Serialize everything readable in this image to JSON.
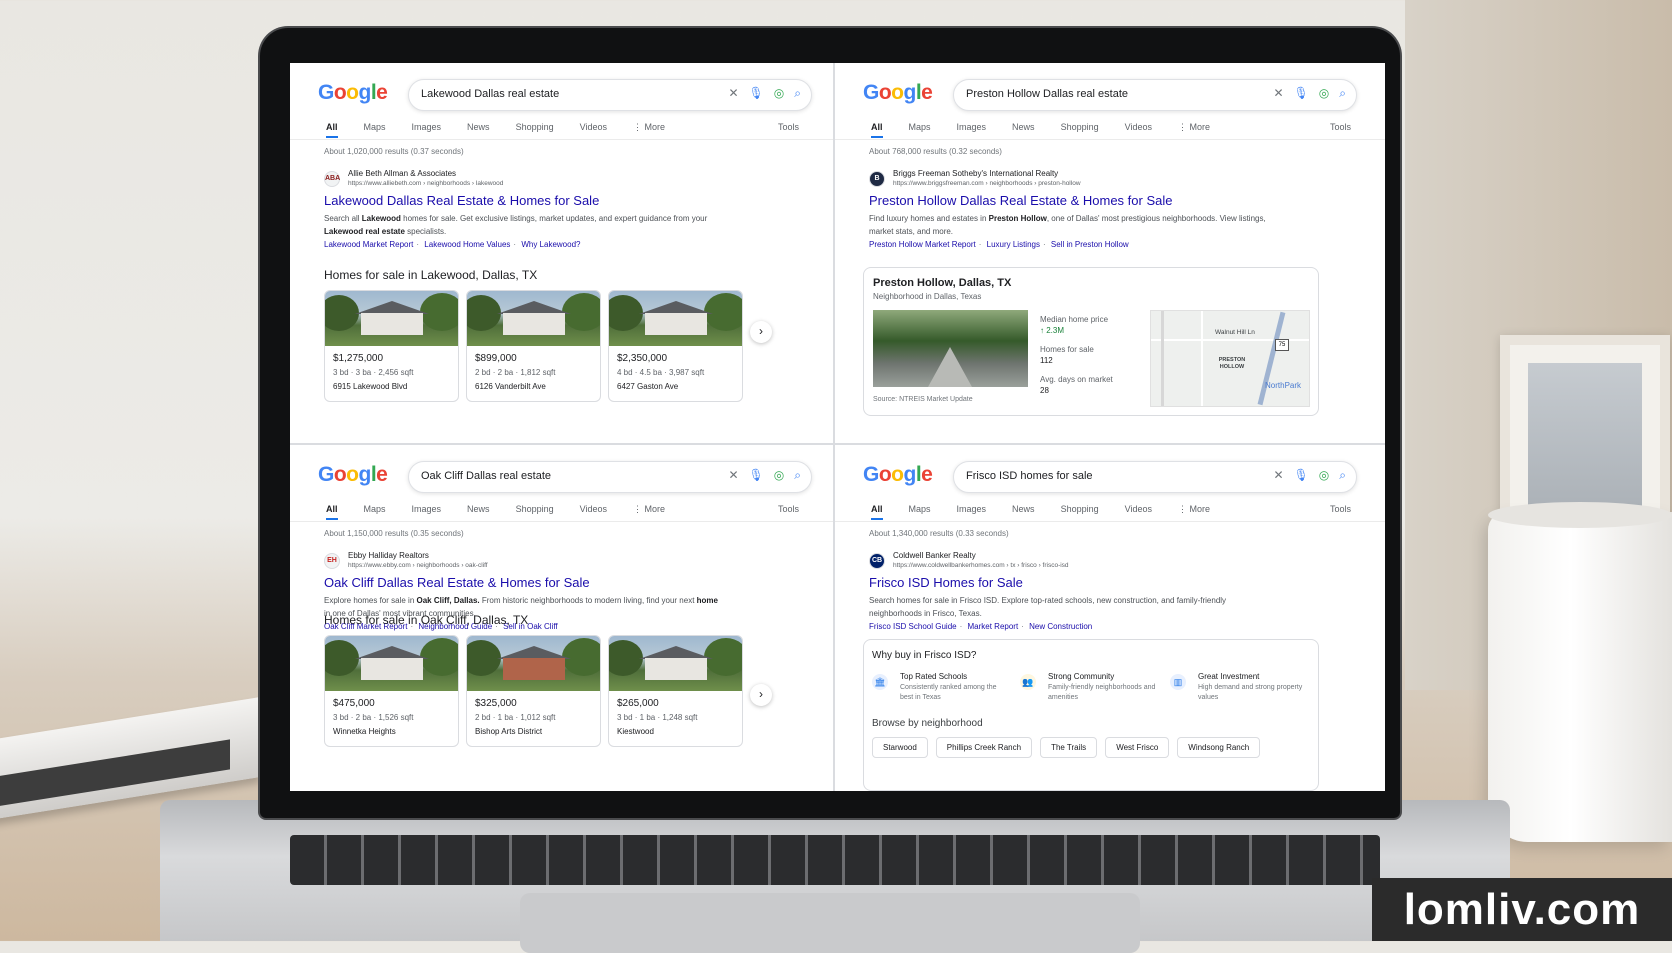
{
  "watermark": "lomliv.com",
  "panels": {
    "tl": {
      "logo": "Google",
      "query": "Lakewood Dallas real estate",
      "tabs": [
        "All",
        "Maps",
        "Images",
        "News",
        "Shopping",
        "Videos",
        "⋮ More"
      ],
      "tools": "Tools",
      "results_count": "About 1,020,000 results (0.37 seconds)",
      "site_name": "Allie Beth Allman & Associates",
      "site_url": "https://www.alliebeth.com › neighborhoods › lakewood",
      "favicon": "ABA",
      "title": "Lakewood Dallas Real Estate & Homes for Sale",
      "snippet_a": "Search all ",
      "snippet_b": "Lakewood",
      "snippet_c": " homes for sale. Get exclusive listings, market updates, and expert guidance from your ",
      "snippet_d": "Lakewood real estate",
      "snippet_e": " specialists.",
      "links": [
        "Lakewood Market Report",
        "Lakewood Home Values",
        "Why Lakewood?"
      ],
      "homes_heading": "Homes for sale in Lakewood, Dallas, TX",
      "homes": [
        {
          "price": "$1,275,000",
          "specs": "3 bd · 3 ba · 2,456 sqft",
          "address": "6915 Lakewood Blvd"
        },
        {
          "price": "$899,000",
          "specs": "2 bd · 2 ba · 1,812 sqft",
          "address": "6126 Vanderbilt Ave"
        },
        {
          "price": "$2,350,000",
          "specs": "4 bd · 4.5 ba · 3,987 sqft",
          "address": "6427 Gaston Ave"
        }
      ]
    },
    "tr": {
      "logo": "Google",
      "query": "Preston Hollow Dallas real estate",
      "tabs": [
        "All",
        "Maps",
        "Images",
        "News",
        "Shopping",
        "Videos",
        "⋮ More"
      ],
      "tools": "Tools",
      "results_count": "About 768,000 results (0.32 seconds)",
      "site_name": "Briggs Freeman Sotheby's International Realty",
      "site_url": "https://www.briggsfreeman.com › neighborhoods › preston-hollow",
      "favicon": "B",
      "title": "Preston Hollow Dallas Real Estate & Homes for Sale",
      "snippet_a": "Find luxury homes and estates in ",
      "snippet_b": "Preston Hollow",
      "snippet_c": ", one of Dallas' most prestigious neighborhoods. View listings, market stats, and more.",
      "links": [
        "Preston Hollow Market Report",
        "Luxury Listings",
        "Sell in Preston Hollow"
      ],
      "kp": {
        "title": "Preston Hollow, Dallas, TX",
        "subtitle": "Neighborhood in Dallas, Texas",
        "median_label": "Median home price",
        "median_value": "↑ 2.3M",
        "homes_label": "Homes for sale",
        "homes_value": "112",
        "days_label": "Avg. days on market",
        "days_value": "28",
        "source": "Source: NTREIS Market Update",
        "map_road": "Walnut Hill Ln",
        "map_area": "PRESTON HOLLOW",
        "map_place": "NorthPark",
        "map_shield": "75"
      }
    },
    "bl": {
      "logo": "Google",
      "query": "Oak Cliff Dallas real estate",
      "tabs": [
        "All",
        "Maps",
        "Images",
        "News",
        "Shopping",
        "Videos",
        "⋮ More"
      ],
      "tools": "Tools",
      "results_count": "About 1,150,000 results (0.35 seconds)",
      "site_name": "Ebby Halliday Realtors",
      "site_url": "https://www.ebby.com › neighborhoods › oak-cliff",
      "favicon": "EH",
      "title": "Oak Cliff Dallas Real Estate & Homes for Sale",
      "snippet_a": "Explore homes for sale in ",
      "snippet_b": "Oak Cliff, Dallas.",
      "snippet_c": " From historic neighborhoods to modern living, find your next ",
      "snippet_d": "home",
      "snippet_e": " in one of Dallas' most vibrant communities.",
      "links": [
        "Oak Cliff Market Report",
        "Neighborhood Guide",
        "Sell in Oak Cliff"
      ],
      "homes_heading": "Homes for sale in Oak Cliff, Dallas, TX",
      "homes": [
        {
          "price": "$475,000",
          "specs": "3 bd · 2 ba · 1,526 sqft",
          "address": "Winnetka Heights"
        },
        {
          "price": "$325,000",
          "specs": "2 bd · 1 ba · 1,012 sqft",
          "address": "Bishop Arts District"
        },
        {
          "price": "$265,000",
          "specs": "3 bd · 1 ba · 1,248 sqft",
          "address": "Kiestwood"
        }
      ]
    },
    "br": {
      "logo": "Google",
      "query": "Frisco ISD homes for sale",
      "tabs": [
        "All",
        "Maps",
        "Images",
        "News",
        "Shopping",
        "Videos",
        "⋮ More"
      ],
      "tools": "Tools",
      "results_count": "About 1,340,000 results (0.33 seconds)",
      "site_name": "Coldwell Banker Realty",
      "site_url": "https://www.coldwellbankerhomes.com › tx › frisco › frisco-isd",
      "favicon": "CB",
      "title": "Frisco ISD Homes for Sale",
      "snippet_a": "Search homes for sale in Frisco ISD. Explore top-rated schools, new construction, and family-friendly neighborhoods in Frisco, Texas.",
      "links": [
        "Frisco ISD School Guide",
        "Market Report",
        "New Construction"
      ],
      "why": {
        "title": "Why buy in Frisco ISD?",
        "features": [
          {
            "title": "Top Rated Schools",
            "desc": "Consistently ranked among the best in Texas"
          },
          {
            "title": "Strong Community",
            "desc": "Family-friendly neighborhoods and amenities"
          },
          {
            "title": "Great Investment",
            "desc": "High demand and strong property values"
          }
        ],
        "browse": "Browse by neighborhood",
        "chips": [
          "Starwood",
          "Phillips Creek Ranch",
          "The Trails",
          "West Frisco",
          "Windsong Ranch"
        ]
      }
    }
  }
}
